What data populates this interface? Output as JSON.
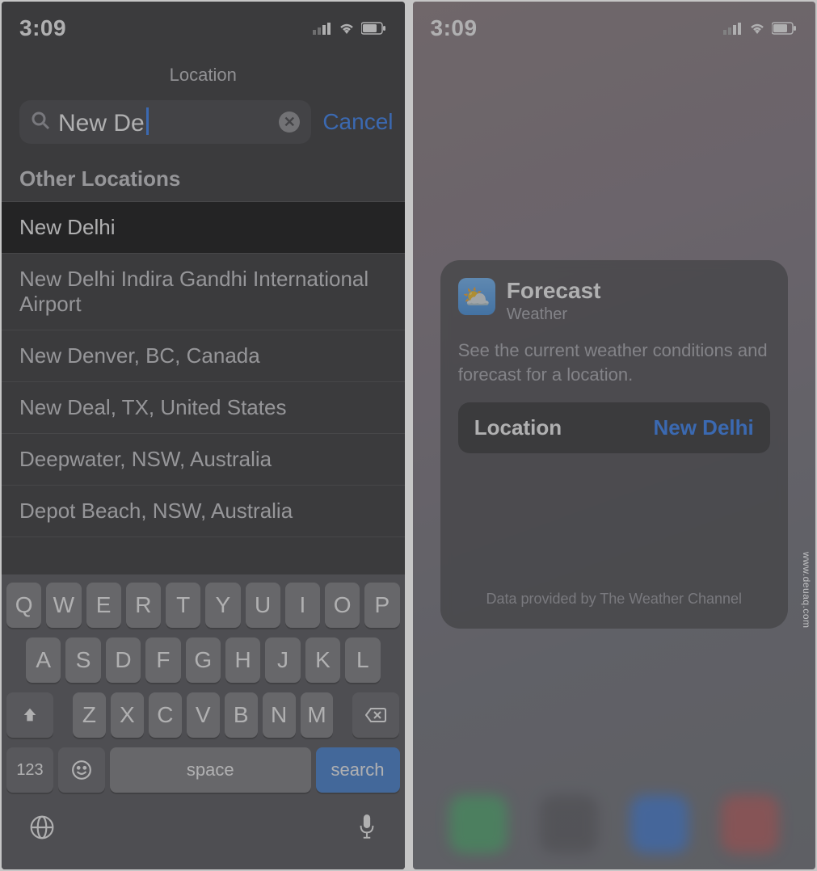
{
  "left": {
    "status": {
      "time": "3:09"
    },
    "title": "Location",
    "search": {
      "query": "New De",
      "cancel": "Cancel"
    },
    "section_header": "Other Locations",
    "results": [
      "New Delhi",
      "New Delhi Indira Gandhi International Airport",
      "New Denver, BC, Canada",
      "New Deal, TX, United States",
      "Deepwater, NSW, Australia",
      "Depot Beach, NSW, Australia"
    ],
    "keyboard": {
      "row1": [
        "Q",
        "W",
        "E",
        "R",
        "T",
        "Y",
        "U",
        "I",
        "O",
        "P"
      ],
      "row2": [
        "A",
        "S",
        "D",
        "F",
        "G",
        "H",
        "J",
        "K",
        "L"
      ],
      "row3": [
        "Z",
        "X",
        "C",
        "V",
        "B",
        "N",
        "M"
      ],
      "key_123": "123",
      "space": "space",
      "search": "search"
    }
  },
  "right": {
    "status": {
      "time": "3:09"
    },
    "card": {
      "title": "Forecast",
      "subtitle": "Weather",
      "desc": "See the current weather conditions and forecast for a location.",
      "location_label": "Location",
      "location_value": "New Delhi",
      "footer": "Data provided by The Weather Channel"
    }
  },
  "watermark": "www.deuaq.com"
}
